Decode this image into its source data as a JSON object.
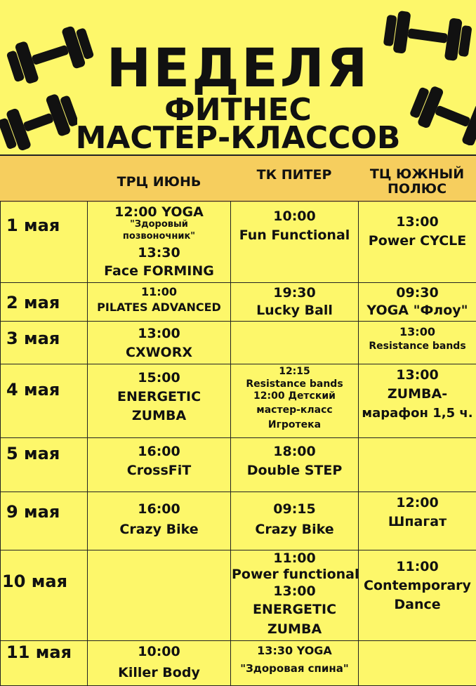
{
  "title": {
    "line1": "НЕДЕЛЯ",
    "line2": "ФИТНЕС",
    "line3": "МАСТЕР-КЛАССОВ"
  },
  "header": {
    "col1": "ТРЦ ИЮНЬ",
    "col2": "ТК ПИТЕР",
    "col3": "ТЦ ЮЖНЫЙ ПОЛЮС"
  },
  "rows": [
    {
      "date": "1 мая",
      "c1": [
        "12:00 YOGA",
        "\"Здоровый",
        "позвоночник\"",
        "13:30",
        "Face FORMING"
      ],
      "c2": [
        "10:00",
        "Fun Functional"
      ],
      "c3": [
        "13:00",
        "Power CYCLE"
      ]
    },
    {
      "date": "2 мая",
      "c1": [
        "11:00",
        "PILATES ADVANCED"
      ],
      "c2": [
        "19:30",
        "Lucky Ball"
      ],
      "c3": [
        "09:30",
        "YOGA \"Флоу\""
      ]
    },
    {
      "date": "3 мая",
      "c1": [
        "13:00",
        "CXWORX"
      ],
      "c2": [],
      "c3": [
        "13:00",
        "Resistance bands"
      ]
    },
    {
      "date": "4 мая",
      "c1": [
        "15:00",
        "ENERGETIC",
        "ZUMBA"
      ],
      "c2": [
        "12:15",
        "Resistance bands",
        "12:00 Детский",
        "мастер-класс",
        "Игротека"
      ],
      "c3": [
        "13:00",
        "ZUMBA-",
        "марафон 1,5 ч."
      ]
    },
    {
      "date": "5 мая",
      "c1": [
        "16:00",
        "CrossFiT"
      ],
      "c2": [
        "18:00",
        "Double STEP"
      ],
      "c3": []
    },
    {
      "date": "9 мая",
      "c1": [
        "16:00",
        "Crazy Bike"
      ],
      "c2": [
        "09:15",
        "Crazy Bike"
      ],
      "c3": [
        "12:00",
        "Шпагат"
      ]
    },
    {
      "date": "10 мая",
      "c1": [],
      "c2": [
        "11:00",
        "Power functional",
        "13:00",
        "ENERGETIC",
        "ZUMBA"
      ],
      "c3": [
        "11:00",
        "Contemporary",
        "Dance"
      ]
    },
    {
      "date": "11 мая",
      "c1": [
        "10:00",
        "Killer Body"
      ],
      "c2": [
        "13:30 YOGA",
        "\"Здоровая спина\""
      ],
      "c3": []
    }
  ],
  "icons": {
    "decoration": "dumbbell-icon",
    "color": "#111111",
    "background": "#fdf76a",
    "header_band": "#f6ce5e"
  }
}
